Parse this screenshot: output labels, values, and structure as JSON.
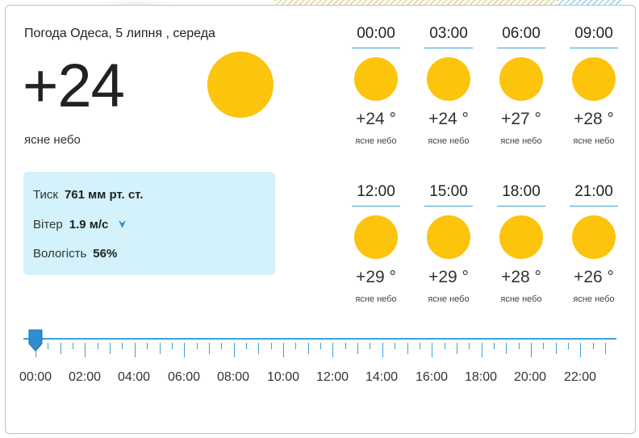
{
  "header": {
    "title": "Погода Одеса, 5 липня , середа",
    "temperature": "+24",
    "description": "ясне небо",
    "sun_color": "#fcc40c"
  },
  "details": {
    "pressure_label": "Тиск",
    "pressure_value": "761 мм рт. ст.",
    "wind_label": "Вітер",
    "wind_value": "1.9 м/с",
    "wind_icon": "arrow-down-icon",
    "humidity_label": "Вологість",
    "humidity_value": "56%",
    "panel_color": "#d3f2fb"
  },
  "forecast": [
    {
      "time": "00:00",
      "temp": "+24 °",
      "desc": "ясне небо",
      "icon": "sun-icon"
    },
    {
      "time": "03:00",
      "temp": "+24 °",
      "desc": "ясне небо",
      "icon": "sun-icon"
    },
    {
      "time": "06:00",
      "temp": "+27 °",
      "desc": "ясне небо",
      "icon": "sun-icon"
    },
    {
      "time": "09:00",
      "temp": "+28 °",
      "desc": "ясне небо",
      "icon": "sun-icon"
    },
    {
      "time": "12:00",
      "temp": "+29 °",
      "desc": "ясне небо",
      "icon": "sun-icon"
    },
    {
      "time": "15:00",
      "temp": "+29 °",
      "desc": "ясне небо",
      "icon": "sun-icon"
    },
    {
      "time": "18:00",
      "temp": "+28 °",
      "desc": "ясне небо",
      "icon": "sun-icon"
    },
    {
      "time": "21:00",
      "temp": "+26 °",
      "desc": "ясне небо",
      "icon": "sun-icon"
    }
  ],
  "timeline": {
    "hours": [
      "00:00",
      "02:00",
      "04:00",
      "06:00",
      "08:00",
      "10:00",
      "12:00",
      "14:00",
      "16:00",
      "18:00",
      "20:00",
      "22:00"
    ],
    "selected": "00:00",
    "accent_color": "#3aa1d8"
  }
}
